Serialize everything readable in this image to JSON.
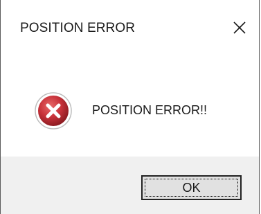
{
  "window": {
    "title": "POSITION ERROR",
    "close_icon": "close-icon"
  },
  "content": {
    "icon": "error-icon",
    "icon_color": "#c8323a",
    "message": "POSITION ERROR!!"
  },
  "footer": {
    "ok_label": "OK",
    "background": "#f0f0f0"
  }
}
